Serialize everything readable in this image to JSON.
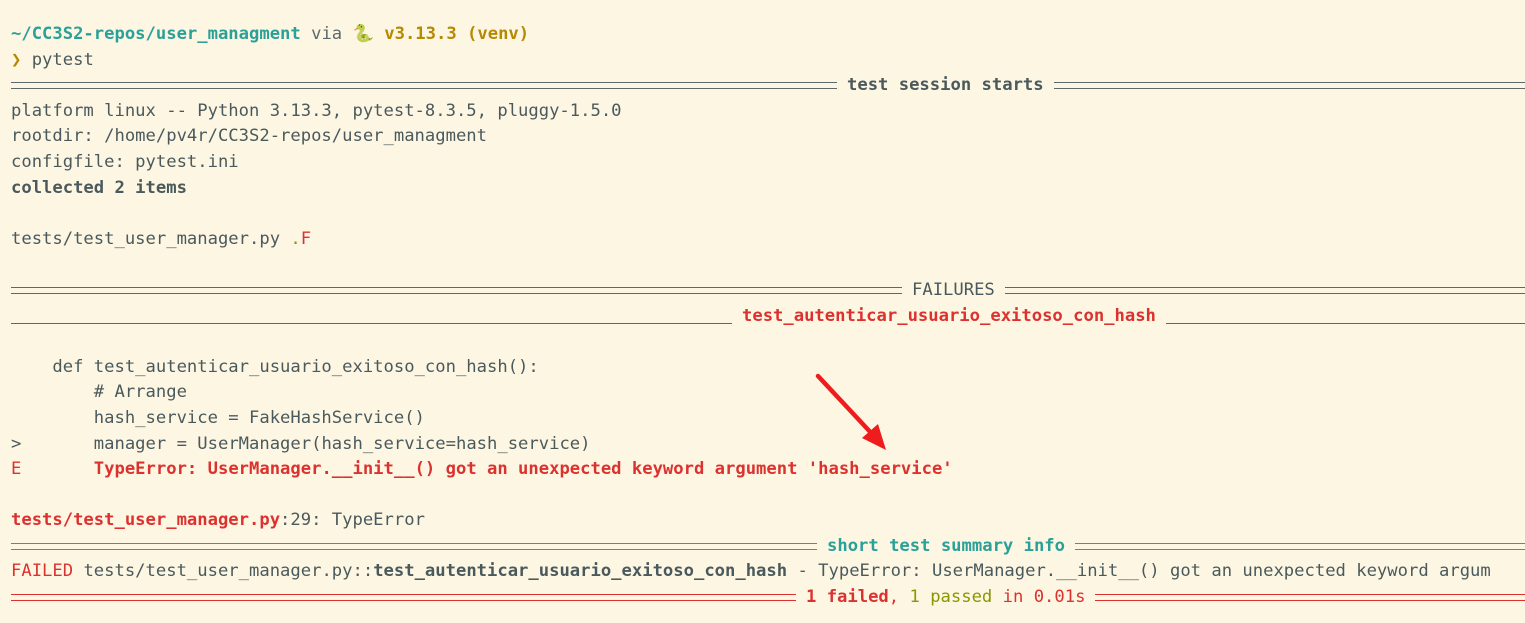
{
  "prompt": {
    "path": "~/CC3S2-repos/user_managment",
    "via": " via ",
    "python_icon": "🐍",
    "python_version": " v3.13.3 (venv)",
    "symbol": "❯",
    "command": " pytest"
  },
  "session": {
    "header": "test session starts",
    "platform": "platform linux -- Python 3.13.3, pytest-8.3.5, pluggy-1.5.0",
    "rootdir": "rootdir: /home/pv4r/CC3S2-repos/user_managment",
    "configfile": "configfile: pytest.ini",
    "collected": "collected 2 items",
    "test_file": "tests/test_user_manager.py ",
    "result_pass": ".",
    "result_fail": "F"
  },
  "failures": {
    "header": "FAILURES",
    "test_name": "test_autenticar_usuario_exitoso_con_hash",
    "code": [
      "    def test_autenticar_usuario_exitoso_con_hash():",
      "        # Arrange",
      "        hash_service = FakeHashService()"
    ],
    "marker_line": ">",
    "failing_line": "       manager = UserManager(hash_service=hash_service)",
    "error_marker": "E",
    "error_text": "       TypeError: UserManager.__init__() got an unexpected keyword argument 'hash_service'",
    "location_file": "tests/test_user_manager.py",
    "location_rest": ":29: TypeError"
  },
  "summary": {
    "header": "short test summary info",
    "failed_label": "FAILED",
    "failed_path": " tests/test_user_manager.py::",
    "failed_test": "test_autenticar_usuario_exitoso_con_hash",
    "failed_message": " - TypeError: UserManager.__init__() got an unexpected keyword argum",
    "failed_count": "1 failed",
    "separator": ", ",
    "passed_count": "1 passed",
    "duration": " in 0.01s"
  },
  "colors": {
    "background": "#fdf6e3",
    "cyan": "#2aa198",
    "red": "#dc322f",
    "yellow": "#b58900",
    "green": "#859900",
    "text": "#4a5a5c"
  }
}
